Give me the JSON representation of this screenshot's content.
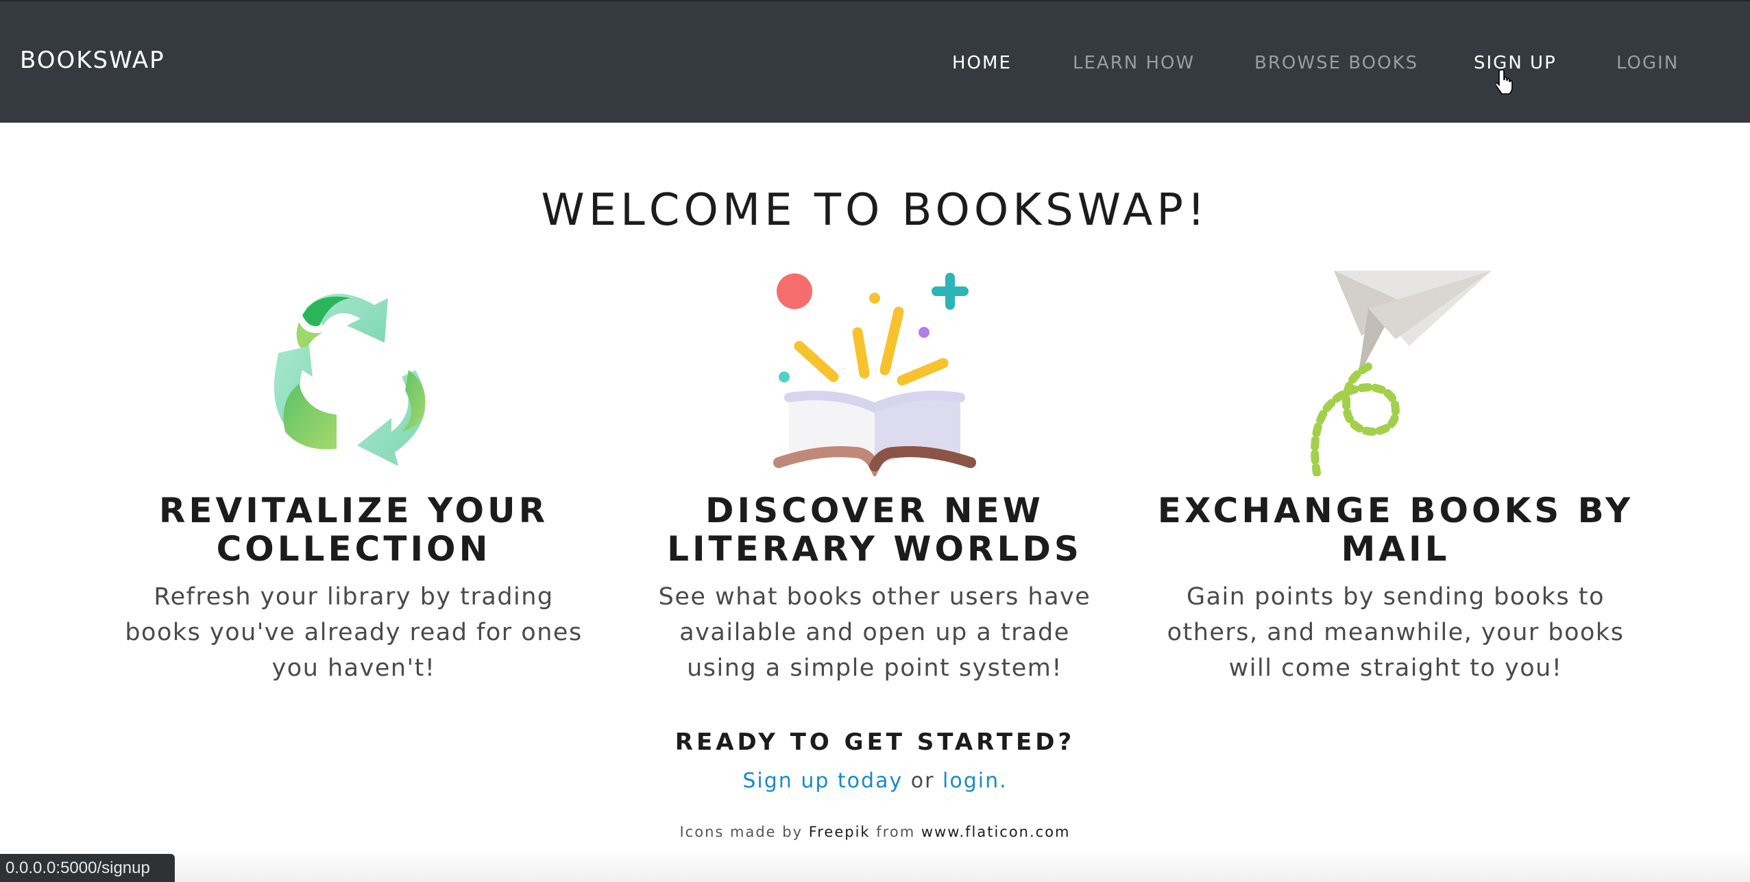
{
  "navbar": {
    "brand": "BOOKSWAP",
    "links": [
      {
        "label": "HOME"
      },
      {
        "label": "LEARN HOW"
      },
      {
        "label": "BROWSE BOOKS"
      },
      {
        "label": "SIGN UP"
      },
      {
        "label": "LOGIN"
      }
    ]
  },
  "main": {
    "title": "WELCOME TO BOOKSWAP!",
    "features": [
      {
        "icon": "recycle-icon",
        "heading": "REVITALIZE YOUR COLLECTION",
        "text": "Refresh your library by trading books you've already read for ones you haven't!"
      },
      {
        "icon": "open-book-icon",
        "heading": "DISCOVER NEW LITERARY WORLDS",
        "text": "See what books other users have available and open up a trade using a simple point system!"
      },
      {
        "icon": "paper-plane-icon",
        "heading": "EXCHANGE BOOKS BY MAIL",
        "text": "Gain points by sending books to others, and meanwhile, your books will come straight to you!"
      }
    ],
    "cta_heading": "READY TO GET STARTED?",
    "cta_signup": "Sign up today",
    "cta_or": "or",
    "cta_login": "login.",
    "attribution_prefix": "Icons made by",
    "attribution_author": "Freepik",
    "attribution_from": "from",
    "attribution_site": "www.flaticon.com"
  },
  "status_bar": {
    "url": "0.0.0.0:5000/signup"
  },
  "colors": {
    "navbar_bg": "#343a40",
    "link": "#1a8ac9",
    "nav_inactive": "#9a9da1"
  }
}
